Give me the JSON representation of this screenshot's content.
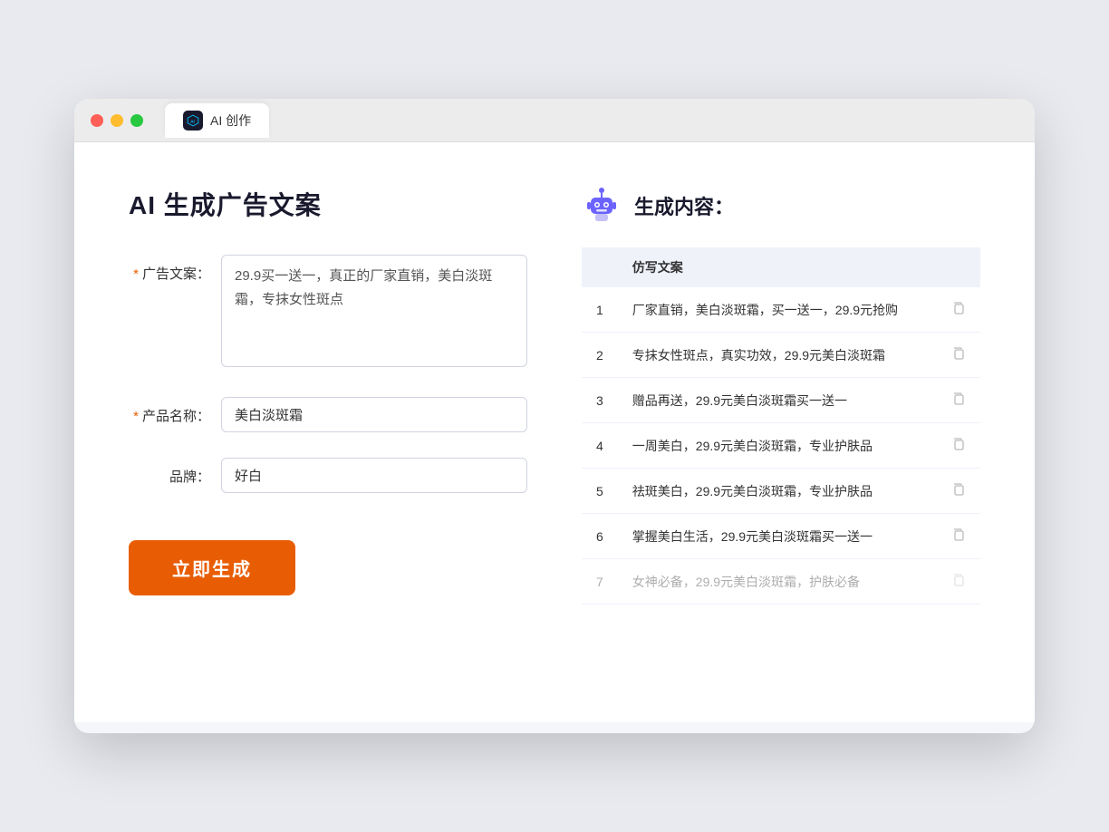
{
  "browser": {
    "tab_label": "AI 创作",
    "traffic_lights": [
      "red",
      "yellow",
      "green"
    ]
  },
  "left": {
    "title": "AI 生成广告文案",
    "form": {
      "ad_copy_label": "广告文案：",
      "ad_copy_required": "*",
      "ad_copy_value": "29.9买一送一，真正的厂家直销，美白淡斑霜，专抹女性斑点",
      "product_name_label": "产品名称：",
      "product_name_required": "*",
      "product_name_value": "美白淡斑霜",
      "brand_label": "品牌：",
      "brand_value": "好白"
    },
    "generate_button": "立即生成"
  },
  "right": {
    "header_title": "生成内容：",
    "table": {
      "column_header": "仿写文案",
      "rows": [
        {
          "num": "1",
          "text": "厂家直销，美白淡斑霜，买一送一，29.9元抢购"
        },
        {
          "num": "2",
          "text": "专抹女性斑点，真实功效，29.9元美白淡斑霜"
        },
        {
          "num": "3",
          "text": "赠品再送，29.9元美白淡斑霜买一送一"
        },
        {
          "num": "4",
          "text": "一周美白，29.9元美白淡斑霜，专业护肤品"
        },
        {
          "num": "5",
          "text": "祛斑美白，29.9元美白淡斑霜，专业护肤品"
        },
        {
          "num": "6",
          "text": "掌握美白生活，29.9元美白淡斑霜买一送一"
        },
        {
          "num": "7",
          "text": "女神必备，29.9元美白淡斑霜，护肤必备"
        }
      ]
    }
  }
}
